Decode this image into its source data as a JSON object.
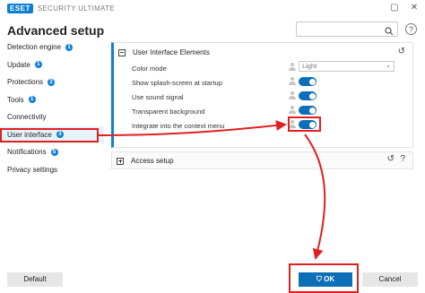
{
  "app": {
    "logo": "ESET",
    "title": "SECURITY ULTIMATE",
    "minimize": "▢",
    "close": "✕"
  },
  "header": {
    "title": "Advanced setup",
    "search_placeholder": "",
    "help": "?"
  },
  "sidebar": {
    "items": [
      {
        "label": "Detection engine",
        "badge": "1"
      },
      {
        "label": "Update",
        "badge": "1"
      },
      {
        "label": "Protections",
        "badge": "2"
      },
      {
        "label": "Tools",
        "badge": "1"
      },
      {
        "label": "Connectivity",
        "badge": ""
      },
      {
        "label": "User interface",
        "badge": "3"
      },
      {
        "label": "Notifications",
        "badge": "5"
      },
      {
        "label": "Privacy settings",
        "badge": ""
      }
    ]
  },
  "section": {
    "title": "User Interface Elements",
    "rows": [
      {
        "label": "Color mode",
        "value": "Light"
      },
      {
        "label": "Show splash-screen at startup",
        "enabled": true
      },
      {
        "label": "Use sound signal",
        "enabled": true
      },
      {
        "label": "Transparent background",
        "enabled": true
      },
      {
        "label": "Integrate into the context menu",
        "enabled": true
      }
    ]
  },
  "section2": {
    "title": "Access setup"
  },
  "footer": {
    "default_label": "Default",
    "ok_label": "OK",
    "cancel_label": "Cancel"
  },
  "colors": {
    "accent": "#0d7fd4",
    "annotation": "#e02020"
  }
}
